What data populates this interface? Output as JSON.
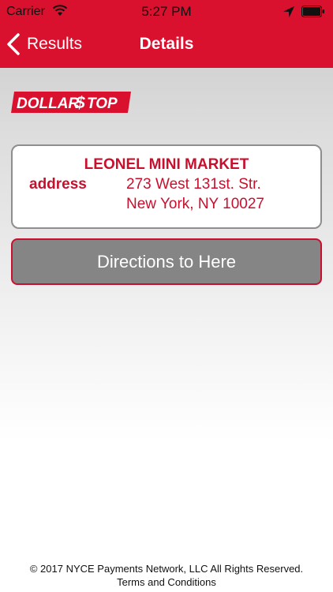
{
  "status_bar": {
    "carrier": "Carrier",
    "time": "5:27 PM"
  },
  "nav": {
    "back_label": "Results",
    "title": "Details"
  },
  "logo": {
    "text_dollar": "DOLLAR",
    "text_s": "$",
    "text_top": "TOP"
  },
  "location": {
    "name": "LEONEL MINI MARKET",
    "address_label": "address",
    "address_line1": "273 West 131st. Str.",
    "address_line2": "New York, NY 10027"
  },
  "directions_label": "Directions to Here",
  "footer": {
    "copyright": "© 2017 NYCE Payments Network, LLC All Rights Reserved.",
    "terms": "Terms and Conditions"
  },
  "colors": {
    "brand_red": "#d9102e",
    "text_red": "#c8102e",
    "button_gray": "#858585"
  }
}
